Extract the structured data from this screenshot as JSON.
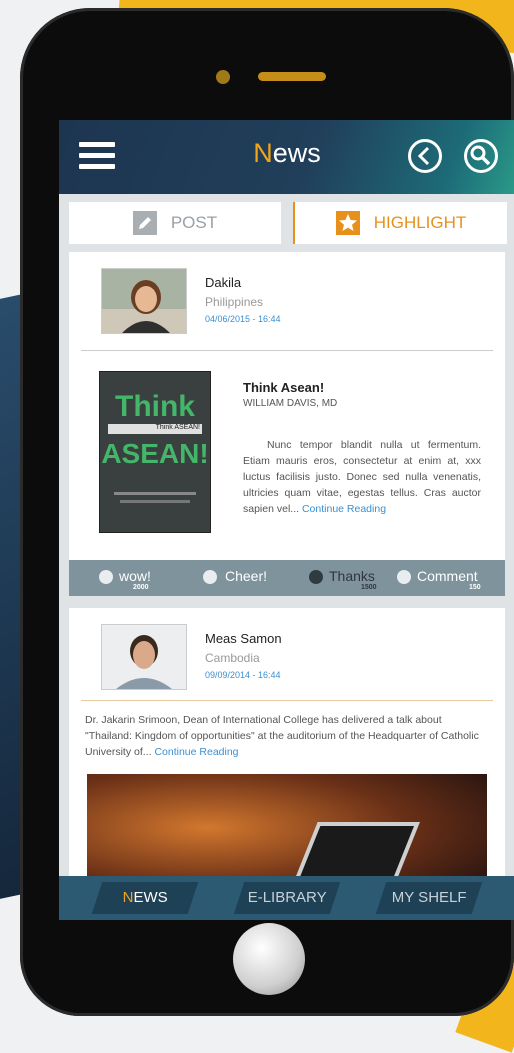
{
  "header": {
    "title_first": "N",
    "title_rest": "ews",
    "menu_icon": "hamburger-icon",
    "back_icon": "chevron-left-circle-icon",
    "search_icon": "search-circle-icon"
  },
  "tabs": [
    {
      "label": "POST",
      "icon": "pencil-icon",
      "color": "#9aa0a6"
    },
    {
      "label": "HIGHLIGHT",
      "icon": "star-icon",
      "color": "#e7911c"
    }
  ],
  "posts": [
    {
      "user": "Dakila",
      "country": "Philippines",
      "date": "04/06/2015 - 16:44",
      "book": {
        "cover_line1": "Think",
        "cover_banner": "Think ASEAN!",
        "cover_line2": "ASEAN!",
        "title": "Think  Asean!",
        "author": "WILLIAM   DAVIS, MD",
        "excerpt": "Nunc tempor blandit nulla ut fermentum. Etiam mauris eros, consectetur at enim at, xxx luctus facilisis justo. Donec sed nulla venenatis, ultricies quam vitae, egestas tellus. Cras auctor sapien vel...",
        "continue": "Continue Reading"
      },
      "actions": [
        {
          "label": "wow!",
          "count": "2000",
          "icon": "star-badge-icon"
        },
        {
          "label": "Cheer!",
          "count": "",
          "icon": "cheer-icon"
        },
        {
          "label": "Thanks",
          "count": "1500",
          "icon": "smile-icon"
        },
        {
          "label": "Comment",
          "count": "150",
          "icon": "comment-icon"
        }
      ]
    },
    {
      "user": "Meas Samon",
      "country": "Cambodia",
      "date": "09/09/2014 - 16:44",
      "text": "Dr. Jakarin Srimoon, Dean of International College has delivered a talk about \"Thailand: Kingdom of opportunities\"  at the auditorium of the Headquarter of Catholic University of...",
      "continue": "Continue Reading"
    }
  ],
  "bottom_nav": [
    {
      "first": "N",
      "rest": "EWS",
      "active": true
    },
    {
      "first": "",
      "rest": "E-LIBRARY",
      "active": false
    },
    {
      "first": "",
      "rest": "MY SHELF",
      "active": false
    }
  ],
  "colors": {
    "accent": "#f2a51a",
    "link": "#3b8fd1",
    "header": "#1d3550",
    "nav": "#2c5a72"
  }
}
